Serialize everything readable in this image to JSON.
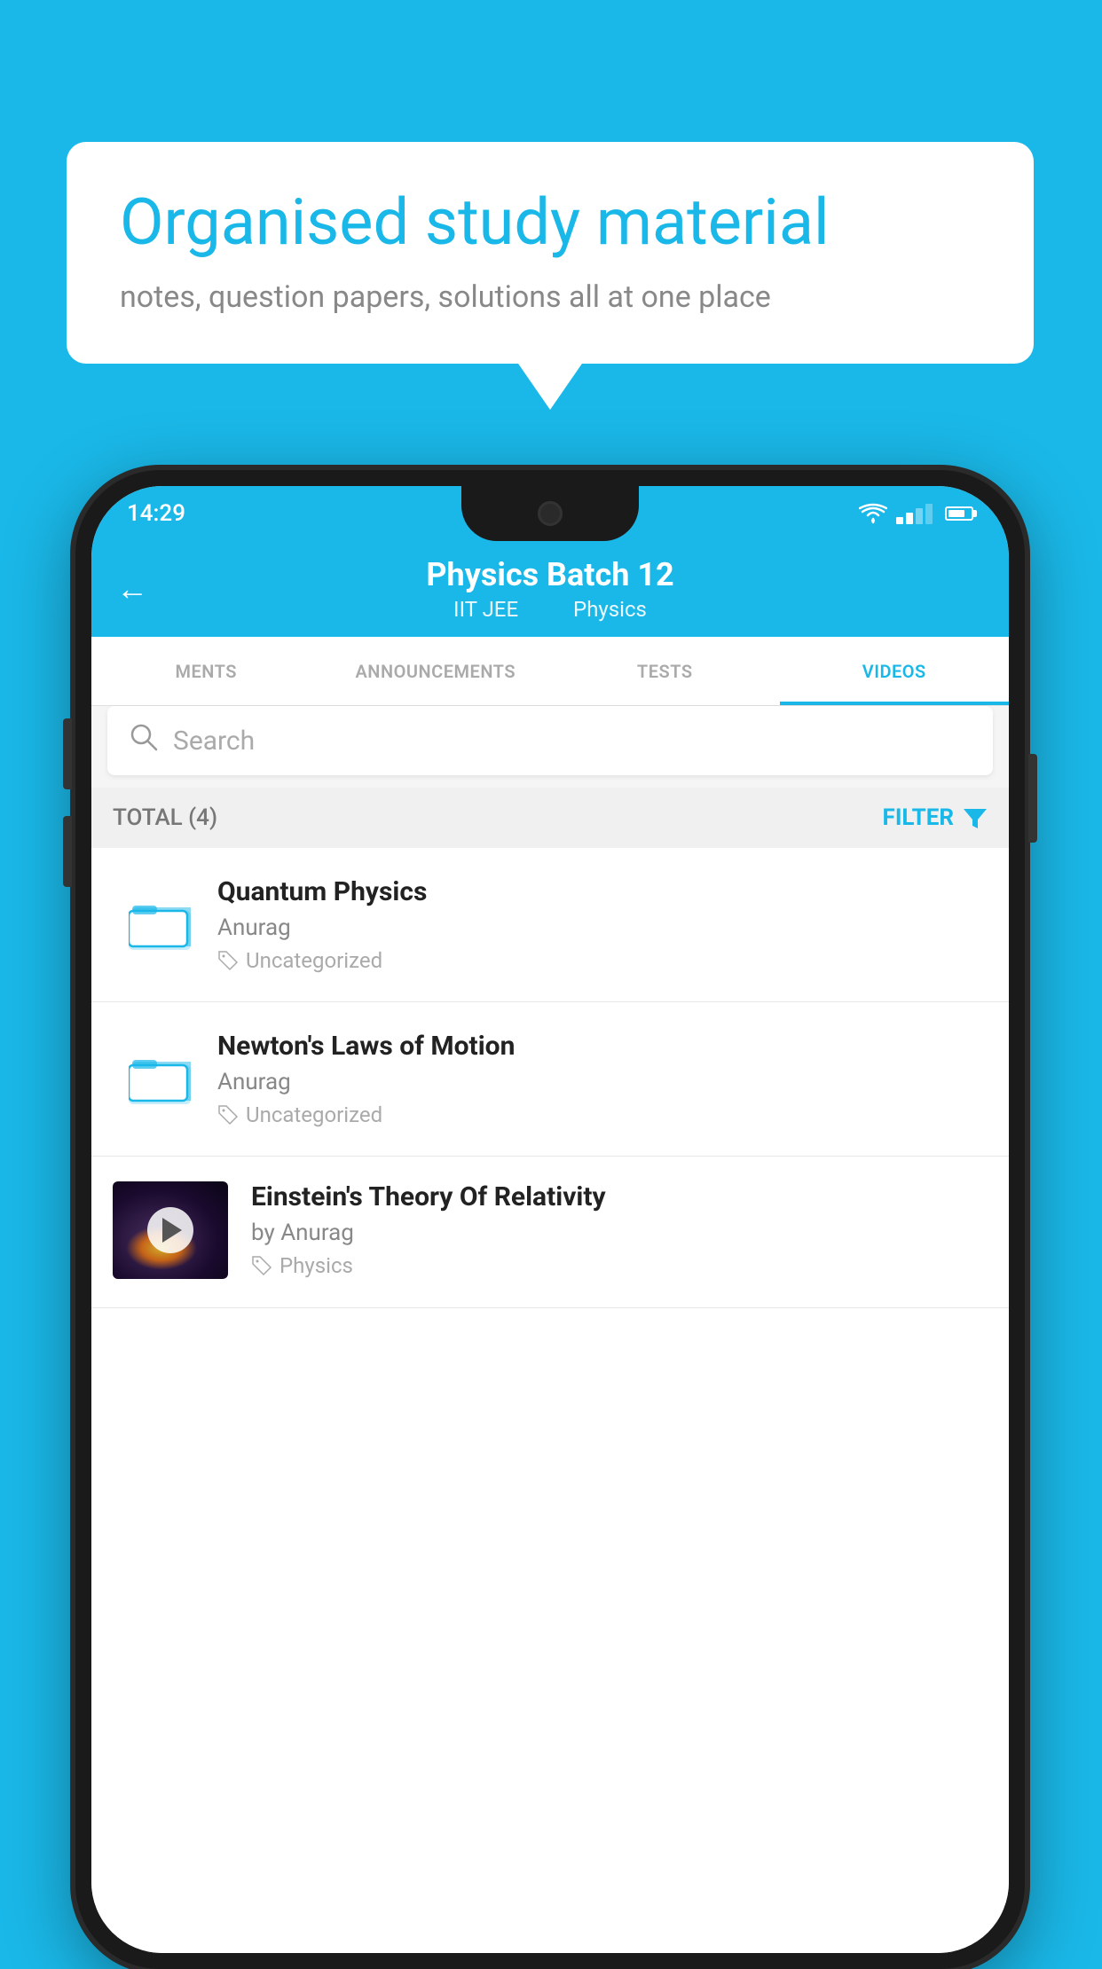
{
  "background_color": "#1ab8e8",
  "speech_bubble": {
    "title": "Organised study material",
    "subtitle": "notes, question papers, solutions all at one place"
  },
  "status_bar": {
    "time": "14:29",
    "wifi": "▲",
    "signal": "▲",
    "battery": "▮"
  },
  "app_header": {
    "title": "Physics Batch 12",
    "subtitle_parts": [
      "IIT JEE",
      "Physics"
    ],
    "back_label": "←"
  },
  "tabs": [
    {
      "label": "MENTS",
      "active": false
    },
    {
      "label": "ANNOUNCEMENTS",
      "active": false
    },
    {
      "label": "TESTS",
      "active": false
    },
    {
      "label": "VIDEOS",
      "active": true
    }
  ],
  "search": {
    "placeholder": "Search"
  },
  "filter_bar": {
    "total_label": "TOTAL (4)",
    "filter_label": "FILTER"
  },
  "videos": [
    {
      "id": 1,
      "title": "Quantum Physics",
      "author": "Anurag",
      "tag": "Uncategorized",
      "has_thumb": false
    },
    {
      "id": 2,
      "title": "Newton's Laws of Motion",
      "author": "Anurag",
      "tag": "Uncategorized",
      "has_thumb": false
    },
    {
      "id": 3,
      "title": "Einstein's Theory Of Relativity",
      "author": "by Anurag",
      "tag": "Physics",
      "has_thumb": true
    }
  ]
}
